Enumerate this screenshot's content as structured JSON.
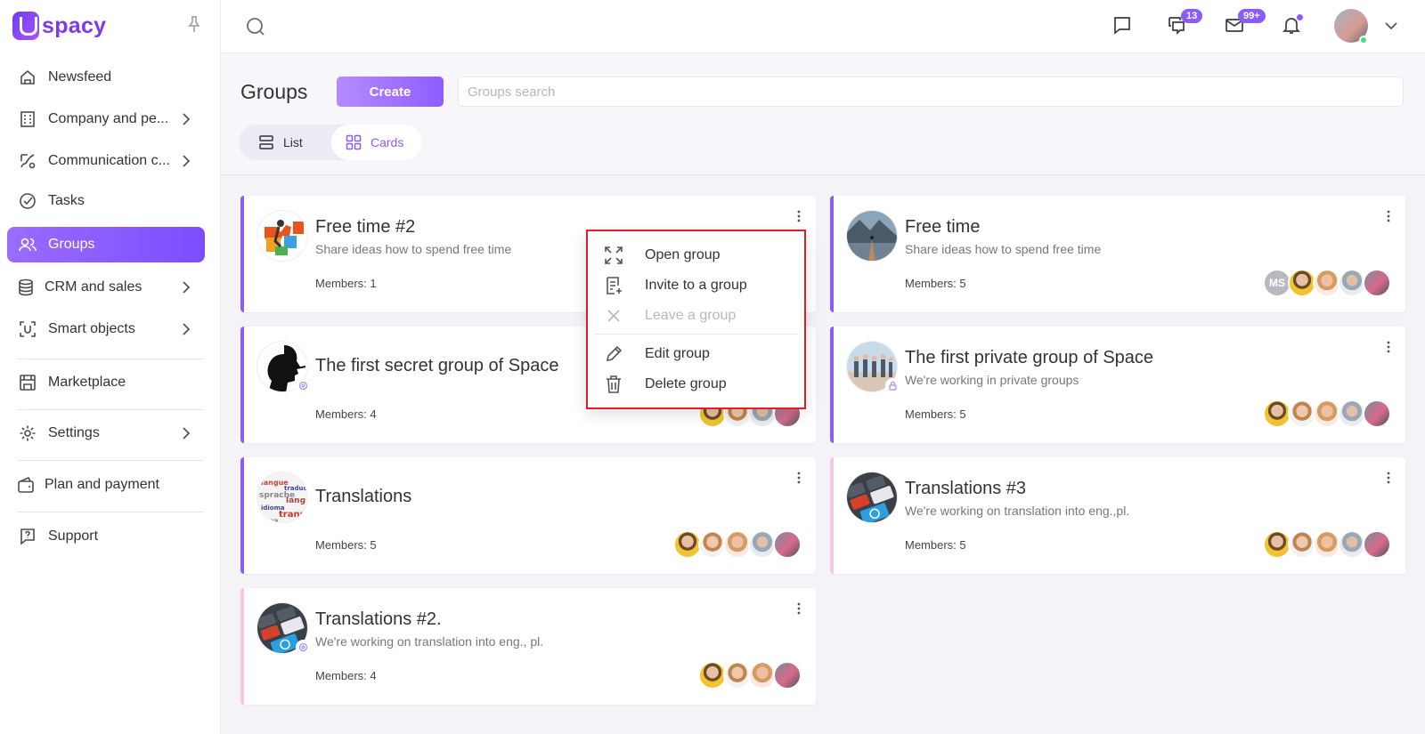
{
  "app": {
    "brand": "spacy"
  },
  "sidebar": {
    "items": [
      {
        "label": "Newsfeed",
        "icon": "home-icon"
      },
      {
        "label": "Company and pe...",
        "icon": "building-icon"
      },
      {
        "label": "Communication c...",
        "icon": "communication-icon"
      },
      {
        "label": "Tasks",
        "icon": "check-circle-icon"
      },
      {
        "label": "Groups",
        "icon": "users-icon",
        "active": true
      },
      {
        "label": "CRM and sales",
        "icon": "database-icon"
      },
      {
        "label": "Smart objects",
        "icon": "scan-icon"
      },
      {
        "label": "Marketplace",
        "icon": "store-icon"
      },
      {
        "label": "Settings",
        "icon": "gear-icon"
      },
      {
        "label": "Plan and payment",
        "icon": "wallet-icon"
      },
      {
        "label": "Support",
        "icon": "help-icon"
      }
    ]
  },
  "topbar": {
    "chat_badge": "13",
    "mail_badge": "99+"
  },
  "header": {
    "title": "Groups",
    "create_label": "Create",
    "search_placeholder": "Groups search",
    "view_list": "List",
    "view_cards": "Cards"
  },
  "groups": [
    {
      "title": "Free time #2",
      "description": "Share ideas how to spend free time",
      "members": "Members: 1"
    },
    {
      "title": "Free time",
      "description": "Share ideas how to spend free time",
      "members": "Members: 5",
      "initials": "MS"
    },
    {
      "title": "The first secret group of Space",
      "description": "",
      "members": "Members: 4"
    },
    {
      "title": "The first private group of Space",
      "description": "We're working in private groups",
      "members": "Members: 5"
    },
    {
      "title": "Translations",
      "description": "",
      "members": "Members: 5"
    },
    {
      "title": "Translations #3",
      "description": "We're working on translation into eng.,pl.",
      "members": "Members: 5"
    },
    {
      "title": "Translations #2.",
      "description": "We're working on translation into eng., pl.",
      "members": "Members: 4"
    }
  ],
  "context_menu": {
    "items": [
      {
        "label": "Open group",
        "icon": "expand-icon"
      },
      {
        "label": "Invite to a group",
        "icon": "invite-icon"
      },
      {
        "label": "Leave a group",
        "icon": "close-icon",
        "disabled": true
      },
      {
        "label": "Edit group",
        "icon": "pencil-icon"
      },
      {
        "label": "Delete group",
        "icon": "trash-icon"
      }
    ]
  },
  "colors": {
    "accent": "#8b5cf6",
    "accent_light": "#f7c6e6",
    "highlight": "#e11d2a"
  }
}
